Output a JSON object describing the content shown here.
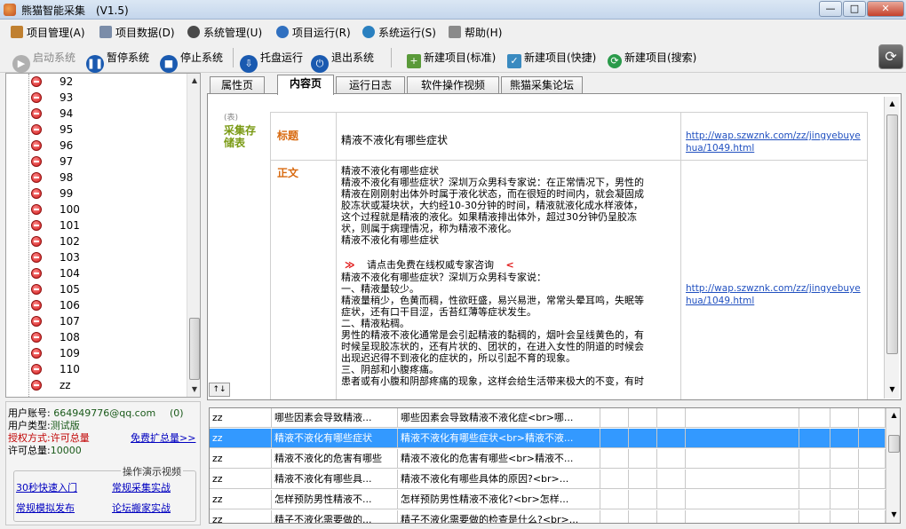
{
  "window": {
    "title": "熊猫智能采集　(V1.5)",
    "min": "—",
    "max": "□",
    "close": "✕"
  },
  "menu": [
    {
      "label": "项目管理(A)",
      "icon": "wrench-icon"
    },
    {
      "label": "项目数据(D)",
      "icon": "table-icon"
    },
    {
      "label": "系统管理(U)",
      "icon": "gear-icon"
    },
    {
      "label": "项目运行(R)",
      "icon": "globe-icon"
    },
    {
      "label": "系统运行(S)",
      "icon": "sync-icon"
    },
    {
      "label": "帮助(H)",
      "icon": "list-icon"
    }
  ],
  "toolbar": {
    "start": "启动系统",
    "pause": "暂停系统",
    "stop": "停止系统",
    "tray": "托盘运行",
    "exit": "退出系统",
    "new_standard": "新建项目(标准)",
    "new_quick": "新建项目(快捷)",
    "new_search": "新建项目(搜索)"
  },
  "tree": {
    "items": [
      "92",
      "93",
      "94",
      "95",
      "96",
      "97",
      "98",
      "99",
      "100",
      "101",
      "102",
      "103",
      "104",
      "105",
      "106",
      "107",
      "108",
      "109",
      "110",
      "zz"
    ]
  },
  "account": {
    "user_label": "用户账号:",
    "user_value": "664949776@qq.com",
    "count": "(0)",
    "type_label": "用户类型:",
    "type_value": "测试版",
    "auth_label": "授权方式:",
    "auth_value": "许可总量",
    "expand_link": "免费扩总量>>",
    "quota_label": "许可总量:",
    "quota_value": "10000",
    "demo_legend": "操作演示视频",
    "demo_links": [
      "30秒快速入门",
      "常规采集实战",
      "常规模拟发布",
      "论坛搬家实战"
    ]
  },
  "tabs": [
    "属性页",
    "内容页",
    "运行日志",
    "软件操作视频",
    "熊猫采集论坛"
  ],
  "content": {
    "side_tag": "(表)",
    "side_title": "采集存储表",
    "title_label": "标题",
    "title_value": "精液不液化有哪些症状",
    "link1": "http://wap.szwznk.com/zz/jingyebuyehua/1049.html",
    "body_label": "正文",
    "body_lines": [
      "精液不液化有哪些症状",
      "精液不液化有哪些症状？深圳万众男科专家说：在正常情况下，男性的",
      "精液在刚刚射出体外时属于液化状态，而在很短的时间内，就会凝固成",
      "胶冻状或凝块状，大约经10-30分钟的时间，精液就液化成水样液体，",
      "这个过程就是精液的液化。如果精液排出体外，超过30分钟仍呈胶冻",
      "状，则属于病理情况，称为精液不液化。",
      "精液不液化有哪些症状"
    ],
    "promo": "请点击免费在线权威专家咨询",
    "promo_left": "≫",
    "promo_right": "<",
    "body_lines2": [
      "精液不液化有哪些症状？深圳万众男科专家说：",
      "一、精液量较少。",
      "精液量稍少，色黄而稠，性欲旺盛，易兴易泄，常常头晕耳鸣，失眠等",
      "症状，还有口干目涩，舌苔红薄等症状发生。",
      "二、精液粘稠。",
      "男性的精液不液化通常是会引起精液的黏稠的，烟叶会呈线黄色的，有",
      "时候呈现胶冻状的，还有片状的、团状的，在进入女性的阴道的时候会",
      "出现迟迟得不到液化的症状的，所以引起不育的现象。",
      "三、阴部和小腹疼痛。",
      "患者或有小腹和阴部疼痛的现象，这样会给生活带来极大的不变，有时"
    ],
    "link2": "http://wap.szwznk.com/zz/jingyebuyehua/1049.html"
  },
  "table": {
    "rows": [
      [
        "zz",
        "哪些因素会导致精液...",
        "哪些因素会导致精液不液化症<br>哪..."
      ],
      [
        "zz",
        "精液不液化有哪些症状",
        "精液不液化有哪些症状<br>精液不液..."
      ],
      [
        "zz",
        "精液不液化的危害有哪些",
        "精液不液化的危害有哪些<br>精液不..."
      ],
      [
        "zz",
        "精液不液化有哪些具...",
        "精液不液化有哪些具体的原因?<br>..."
      ],
      [
        "zz",
        "怎样预防男性精液不...",
        "怎样预防男性精液不液化?<br>怎样..."
      ],
      [
        "zz",
        "精子不液化需要做的...",
        "精子不液化需要做的检查是什么?<br>..."
      ]
    ],
    "selected_index": 1
  }
}
